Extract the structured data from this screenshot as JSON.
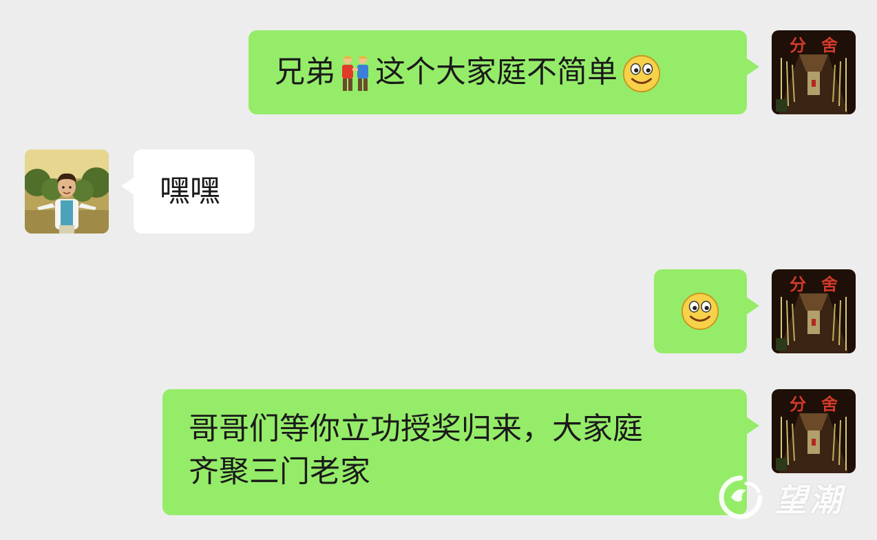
{
  "messages": [
    {
      "side": "right",
      "text_before": "兄弟",
      "text_after": "这个大家庭不简单"
    },
    {
      "side": "left",
      "text": "嘿嘿"
    },
    {
      "side": "right",
      "emoji": "smile"
    },
    {
      "side": "right",
      "line1": "哥哥们等你立功授奖归来，大家庭",
      "line2": "齐聚三门老家"
    }
  ],
  "watermark": {
    "text": "望潮"
  },
  "icons": [
    "brothers-emoji-icon",
    "smile-emoji-icon",
    "self-avatar",
    "friend-avatar",
    "wangchao-logo-icon"
  ]
}
